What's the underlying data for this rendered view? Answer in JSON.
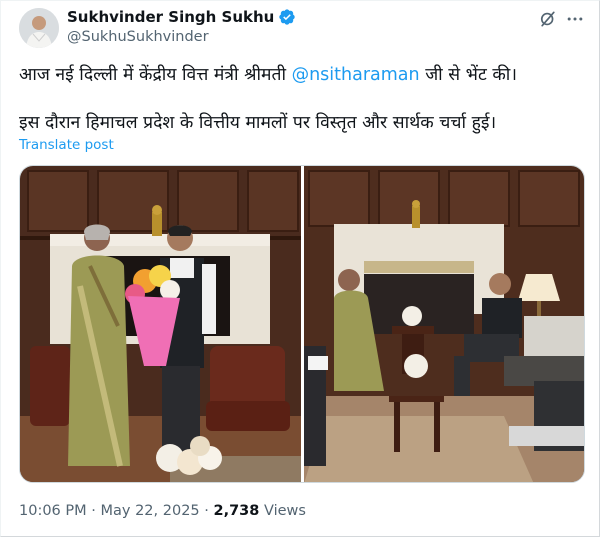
{
  "author": {
    "name": "Sukhvinder Singh Sukhu",
    "handle": "@SukhuSukhvinder",
    "verified_icon": "verified-badge-icon"
  },
  "header_actions": {
    "grok_icon": "grok-icon",
    "more_icon": "more-icon"
  },
  "tweet": {
    "line1_before": "आज नई दिल्ली में केंद्रीय वित्त मंत्री श्रीमती ",
    "mention": "@nsitharaman",
    "line1_after": " जी से भेंट की।",
    "line2": "इस दौरान हिमाचल प्रदेश के वित्तीय मामलों पर विस्तृत और सार्थक चर्चा हुई।",
    "translate_label": "Translate post"
  },
  "meta": {
    "time": "10:06 PM",
    "separator": " · ",
    "date": "May 22, 2025",
    "views_count": "2,738",
    "views_label": " Views"
  },
  "colors": {
    "link": "#1d9bf0",
    "muted": "#536471",
    "text": "#0f1419",
    "verified": "#1d9bf0"
  }
}
